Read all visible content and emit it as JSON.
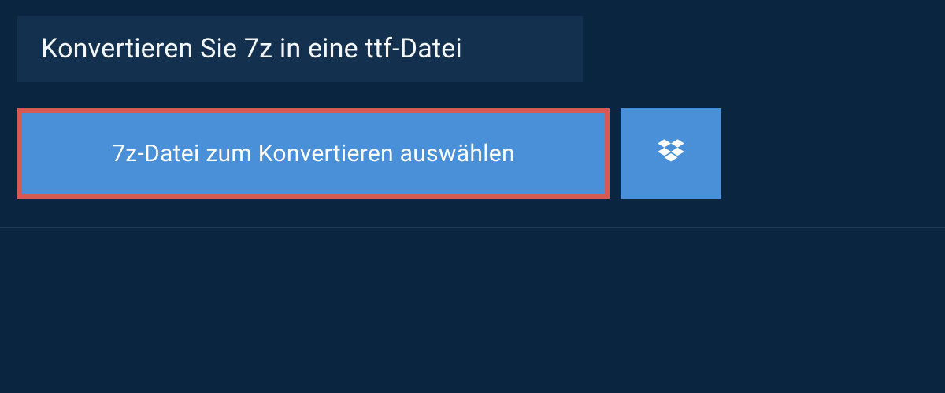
{
  "header": {
    "title": "Konvertieren Sie 7z in eine ttf-Datei"
  },
  "actions": {
    "select_file_label": "7z-Datei zum Konvertieren auswählen",
    "dropbox_icon_name": "dropbox"
  },
  "colors": {
    "background": "#0a2540",
    "header_bg": "#13314f",
    "button_bg": "#4a90d9",
    "button_highlight_border": "#d65a52",
    "text_light": "#ffffff"
  }
}
